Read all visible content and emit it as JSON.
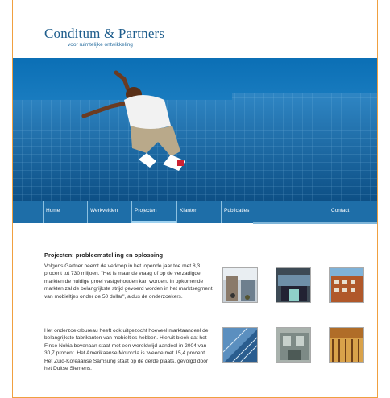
{
  "logo": {
    "name": "Conditum & Partners",
    "tagline": "voor ruimtelijke ontwikkeling"
  },
  "nav": {
    "items": [
      {
        "label": "Home"
      },
      {
        "label": "Werkvelden"
      },
      {
        "label": "Projecten",
        "active": true
      },
      {
        "label": "Klanten"
      },
      {
        "label": "Publicaties"
      },
      {
        "label": "Contact"
      }
    ]
  },
  "content": {
    "title": "Projecten: probleemstelling en oplossing",
    "paragraph1": "Volgens Gartner neemt de verkoop in het lopende jaar toe met 8,3 procent tot 730 miljoen. \"Het is maar de vraag of op de verzadigde markten de huidige groei vastgehouden kan worden. In opkomende markten zal de belangrijkste strijd gevoerd worden in het marktsegment van mobieltjes onder de 50 dollar\", aldus de onderzoekers.",
    "paragraph2": "Het onderzoeksbureau heeft ook uitgezocht hoeveel marktaandeel de belangrijkste fabrikanten van mobieltjes hebben. Hieruit bleek dat het Finse Nokia bovenaan staat met een wereldwijd aandeel in 2004 van 30,7 procent. Het Amerikaanse Motorola is tweede met 15,4 procent. Het Zuid-Koreaanse Samsung staat op de derde plaats, gevolgd door het Duitse Siemens."
  },
  "colors": {
    "brand": "#1e5d8c",
    "nav": "#1e6ea8",
    "frame": "#f0a040"
  }
}
